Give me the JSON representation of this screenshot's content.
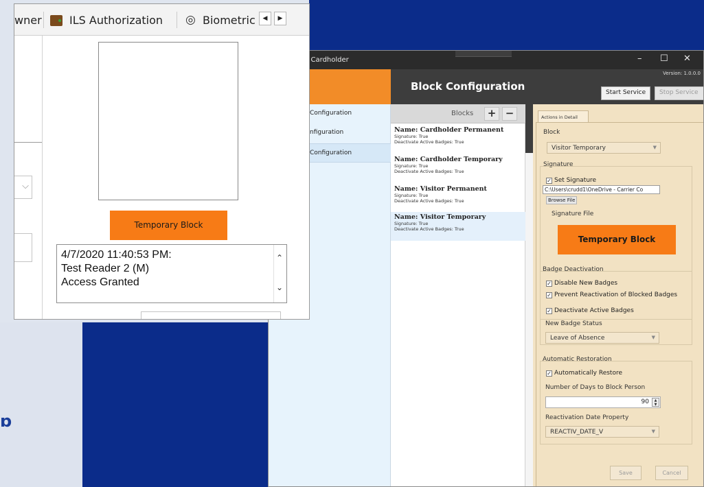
{
  "window": {
    "title": "d Cardholder",
    "version": "Version: 1.0.0.0",
    "header_title": "Block Configuration",
    "start_service": "Start Service",
    "stop_service": "Stop Service"
  },
  "nav": {
    "items": [
      {
        "label": "Configuration"
      },
      {
        "label": "nfiguration"
      },
      {
        "label": "Configuration"
      }
    ]
  },
  "blocks": {
    "header": "Blocks",
    "add_glyph": "+",
    "remove_glyph": "−",
    "items": [
      {
        "name": "Name: Cardholder Permanent",
        "signature": "Signature: True",
        "deactivate": "Deactivate Active Badges: True"
      },
      {
        "name": "Name: Cardholder Temporary",
        "signature": "Signature: True",
        "deactivate": "Deactivate Active Badges: True"
      },
      {
        "name": "Name: Visitor Permanent",
        "signature": "Signature: True",
        "deactivate": "Deactivate Active Badges: True"
      },
      {
        "name": "Name: Visitor Temporary",
        "signature": "Signature: True",
        "deactivate": "Deactivate Active Badges: True"
      }
    ]
  },
  "detail": {
    "tab": "Actions in Detail",
    "block_label": "Block",
    "block_value": "Visitor Temporary",
    "signature_group": "Signature",
    "set_signature": "Set Signature",
    "signature_path": "C:\\Users\\crudd1\\OneDrive - Carrier Co",
    "browse_file": "Browse File",
    "signature_file_label": "Signature File",
    "signature_button": "Temporary Block",
    "badge_group": "Badge Deactivation",
    "disable_new": "Disable New Badges",
    "prevent_reactivation": "Prevent Reactivation of Blocked Badges",
    "deactivate_active": "Deactivate Active Badges",
    "new_badge_status_label": "New Badge Status",
    "new_badge_status_value": "Leave of Absence",
    "restoration_group": "Automatic Restoration",
    "auto_restore": "Automatically Restore",
    "days_label": "Number of Days to Block Person",
    "days_value": "90",
    "reactivation_label": "Reactivation Date Property",
    "reactivation_value": "REACTIV_DATE_V",
    "save": "Save",
    "cancel": "Cancel"
  },
  "overlay": {
    "tab_owner": "wner",
    "tab_ils": "ILS Authorization",
    "tab_bio": "Biometric",
    "temp_block_button": "Temporary Block",
    "log_line1": "4/7/2020 11:40:53 PM:",
    "log_line2": "Test Reader 2 (M)",
    "log_line3": "Access Granted"
  },
  "background": {
    "fragment": "ɒ"
  }
}
